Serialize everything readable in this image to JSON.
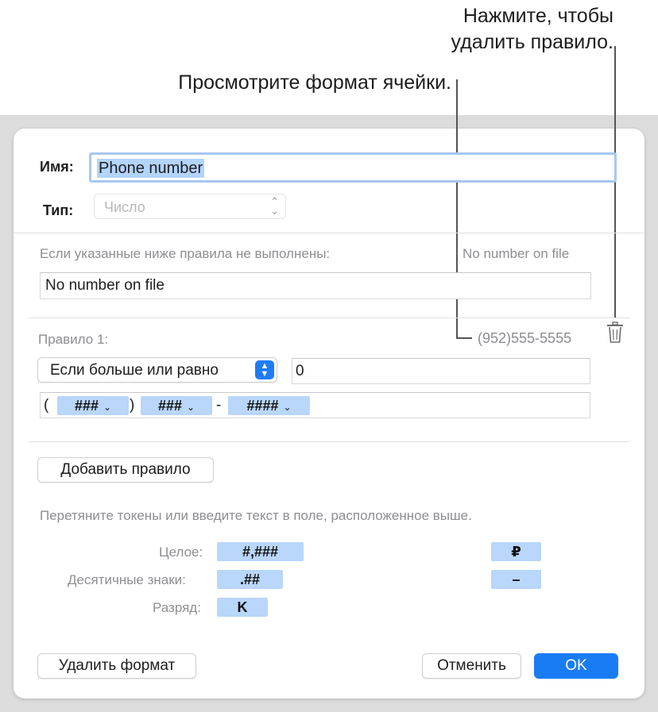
{
  "callouts": {
    "delete_rule": [
      "Нажмите, чтобы",
      "удалить правило."
    ],
    "view_format": "Просмотрите формат ячейки."
  },
  "form": {
    "name_label": "Имя:",
    "name_value": "Phone number",
    "type_label": "Тип:",
    "type_value": "Число"
  },
  "fallback": {
    "label": "Если указанные ниже правила не выполнены:",
    "preview": "No number on file",
    "value": "No number on file"
  },
  "rule": {
    "title": "Правило 1:",
    "preview": "(952)555-5555",
    "condition": "Если больше или равно",
    "condition_value": "0",
    "format_text": [
      "(",
      ")",
      "-"
    ],
    "tokens": [
      "###",
      "###",
      "####"
    ]
  },
  "buttons": {
    "add_rule": "Добавить правило",
    "delete_format": "Удалить формат",
    "cancel": "Отменить",
    "ok": "OK"
  },
  "tokens_help": {
    "instruction": "Перетяните токены или введите текст в поле, расположенное выше.",
    "integer_label": "Целое:",
    "integer_token": "#,###",
    "decimals_label": "Десятичные знаки:",
    "decimals_token": ".##",
    "scale_label": "Разряд:",
    "scale_token": "K",
    "currency_token": "₽",
    "minus_token": "–"
  },
  "colors": {
    "accent": "#1a7cf5",
    "token_fill": "#b9d6fb",
    "focus_ring": "#a7c7f2"
  }
}
